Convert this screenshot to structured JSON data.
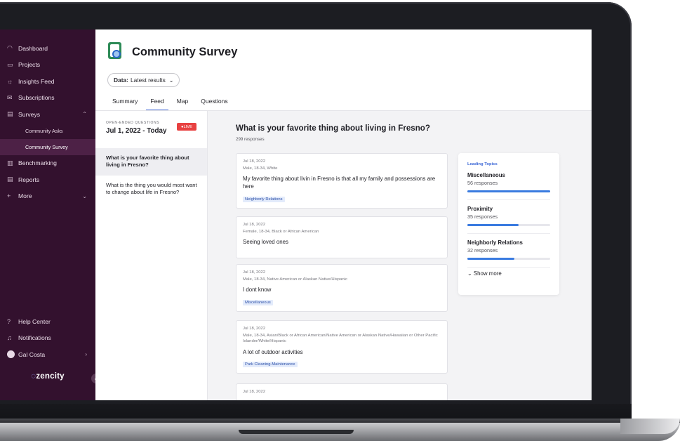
{
  "sidebar": {
    "items": [
      {
        "icon": "◠",
        "label": "Dashboard"
      },
      {
        "icon": "▭",
        "label": "Projects"
      },
      {
        "icon": "☼",
        "label": "Insights Feed"
      },
      {
        "icon": "✉",
        "label": "Subscriptions"
      },
      {
        "icon": "▤",
        "label": "Surveys",
        "chevron": "⌃"
      },
      {
        "label": "Community Asks"
      },
      {
        "label": "Community Survey"
      },
      {
        "icon": "▥",
        "label": "Benchmarking"
      },
      {
        "icon": "▤",
        "label": "Reports"
      },
      {
        "icon": "+",
        "label": "More",
        "chevron": "⌄"
      }
    ],
    "bottom": [
      {
        "icon": "?",
        "label": "Help Center"
      },
      {
        "icon": "♫",
        "label": "Notifications"
      },
      {
        "label": "Gal Costa",
        "chevron": "›"
      }
    ],
    "logo": "zencity",
    "logo_mark": "◌"
  },
  "header": {
    "title": "Community Survey",
    "data_label": "Data:",
    "data_value": "Latest results"
  },
  "tabs": [
    "Summary",
    "Feed",
    "Map",
    "Questions"
  ],
  "questions_panel": {
    "label": "OPEN-ENDED QUESTIONS",
    "date_range": "Jul 1, 2022 - Today",
    "live": "LIVE",
    "questions": [
      "What is your favorite thing about living in Fresno?",
      "What is the thing you would most want to change about life in Fresno?"
    ]
  },
  "feed": {
    "title": "What is your favorite thing about living in Fresno?",
    "count": "299 responses",
    "responses": [
      {
        "date": "Jul 18, 2022",
        "demo": "Male, 18-34, White",
        "text": "My favorite thing about livin in Fresno is that all my family and possessions are here",
        "tag": "Neighborly Relations"
      },
      {
        "date": "Jul 18, 2022",
        "demo": "Female, 18-34, Black or African American",
        "text": "Seeing loved ones",
        "tag": ""
      },
      {
        "date": "Jul 18, 2022",
        "demo": "Male, 18-34, Native American or Alaskan Native/Hispanic",
        "text": "I dont know",
        "tag": "Miscellaneous"
      },
      {
        "date": "Jul 18, 2022",
        "demo": "Male, 18-34, Asian/Black or African American/Native American or Alaskan Native/Hawaiian or Other Pacific Islander/White/Hispanic",
        "text": "A lot of outdoor activities",
        "tag": "Park Cleaning-Maintenance"
      },
      {
        "date": "Jul 18, 2022",
        "demo": "",
        "text": "",
        "tag": ""
      }
    ]
  },
  "topics": {
    "title": "Leading Topics",
    "items": [
      {
        "name": "Miscellaneous",
        "count": "56 responses",
        "share": 1.0
      },
      {
        "name": "Proximity",
        "count": "35 responses",
        "share": 0.62
      },
      {
        "name": "Neighborly Relations",
        "count": "32 responses",
        "share": 0.57
      }
    ],
    "show_more": "Show more",
    "accent": "#3a7be0"
  }
}
